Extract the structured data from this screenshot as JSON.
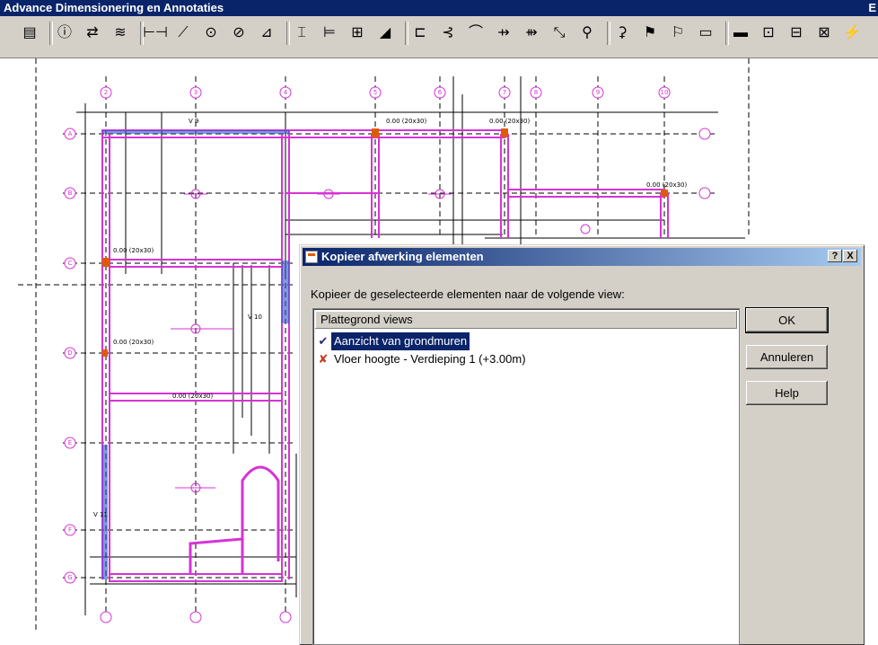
{
  "window": {
    "title": "Advance Dimensionering en Annotaties",
    "title_right": "E"
  },
  "toolbar": {
    "icons": [
      "properties-icon",
      "info-icon",
      "text-style-icon",
      "layers-icon",
      "linear-dimension-icon",
      "aligned-dimension-icon",
      "radius-dimension-icon",
      "diameter-dimension-icon",
      "angle-dimension-icon",
      "grid-dimension-icon",
      "wall-dimension-icon",
      "chain-dimension-icon",
      "level-icon",
      "label-icon",
      "elevation-icon",
      "arc-icon",
      "insert-point-icon",
      "remove-point-icon",
      "stretch-icon",
      "update-icon",
      "copy-icon",
      "annotation-icon",
      "finish-icon",
      "convert-icon",
      "tag-icon",
      "room-tag-icon",
      "door-tag-icon",
      "window-tag-icon",
      "lightning-icon"
    ],
    "glyphs": [
      "▤",
      "ⓘ",
      "⇄",
      "≋",
      "⊢⊣",
      "⟋",
      "⊙",
      "⊘",
      "⊿",
      "⌶",
      "⊨",
      "⊞",
      "◢",
      "⊏",
      "⊰",
      "⌒",
      "⇸",
      "⇻",
      "⤡",
      "⚲",
      "⚳",
      "⚑",
      "⚐",
      "▭",
      "▬",
      "⊡",
      "⊟",
      "⊠",
      "⚡"
    ],
    "accent": "#d4d0c8"
  },
  "drawing": {
    "grid_top": [
      "2",
      "3",
      "4",
      "5",
      "6",
      "7",
      "8",
      "9",
      "10"
    ],
    "grid_left": [
      "A",
      "B",
      "C",
      "D",
      "E",
      "F",
      "G"
    ],
    "labels": [
      "0.00 (20x30)",
      "0.00 (20x30)",
      "0.00 (20x30)",
      "0.00 (20x30)",
      "0.00 (20x30)",
      "0.00 (20x30)",
      "V 9",
      "V 10",
      "V 11"
    ],
    "colors": {
      "beam": "#d633d6",
      "column": "#2855c8",
      "grid": "#000000"
    }
  },
  "dialog": {
    "title": "Kopieer afwerking elementen",
    "help_btn": "?",
    "close_btn": "X",
    "prompt": "Kopieer de geselecteerde elementen naar de volgende view:",
    "list_header": "Plattegrond views",
    "items": [
      {
        "label": "Aanzicht van grondmuren",
        "icon": "check-icon",
        "glyph": "✔",
        "selected": true
      },
      {
        "label": "Vloer hoogte - Verdieping 1 (+3.00m)",
        "icon": "cross-icon",
        "glyph": "✘",
        "selected": false
      }
    ],
    "ok": "OK",
    "cancel": "Annuleren",
    "help": "Help"
  }
}
